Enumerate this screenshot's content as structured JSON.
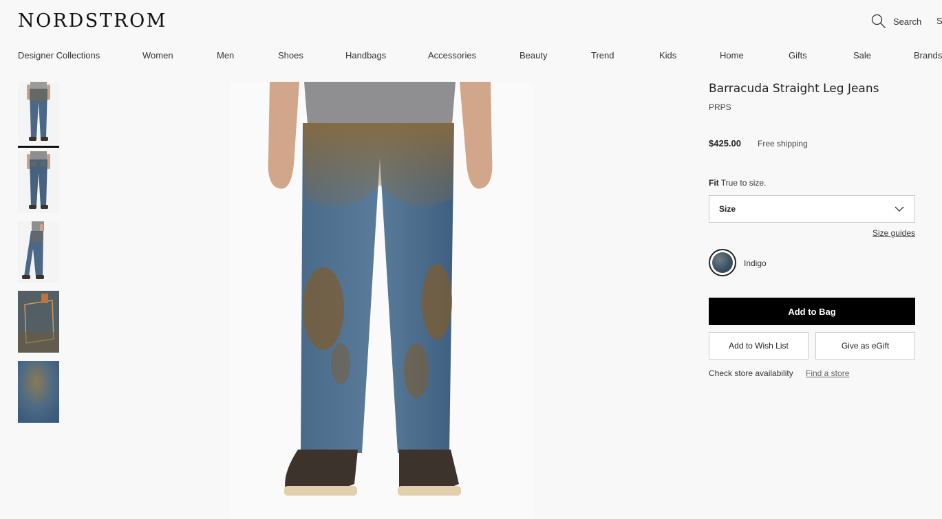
{
  "header": {
    "logo": "NORDSTROM",
    "search_label": "Search",
    "cut_label": "S"
  },
  "nav": [
    "Designer Collections",
    "Women",
    "Men",
    "Shoes",
    "Handbags",
    "Accessories",
    "Beauty",
    "Trend",
    "Kids",
    "Home",
    "Gifts",
    "Sale",
    "Brands"
  ],
  "product": {
    "title": "Barracuda Straight Leg Jeans",
    "brand": "PRPS",
    "price": "$425.00",
    "shipping": "Free shipping",
    "fit_label": "Fit",
    "fit_value": "True to size.",
    "size_placeholder": "Size",
    "size_guides": "Size guides",
    "color_name": "Indigo",
    "add_to_bag": "Add to Bag",
    "wish_list": "Add to Wish List",
    "egift": "Give as eGift",
    "availability": "Check store availability",
    "find_store": "Find a store"
  },
  "colors": {
    "denim": "#3f5d7a",
    "mud": "#8a6a3c",
    "button": "#000000"
  }
}
